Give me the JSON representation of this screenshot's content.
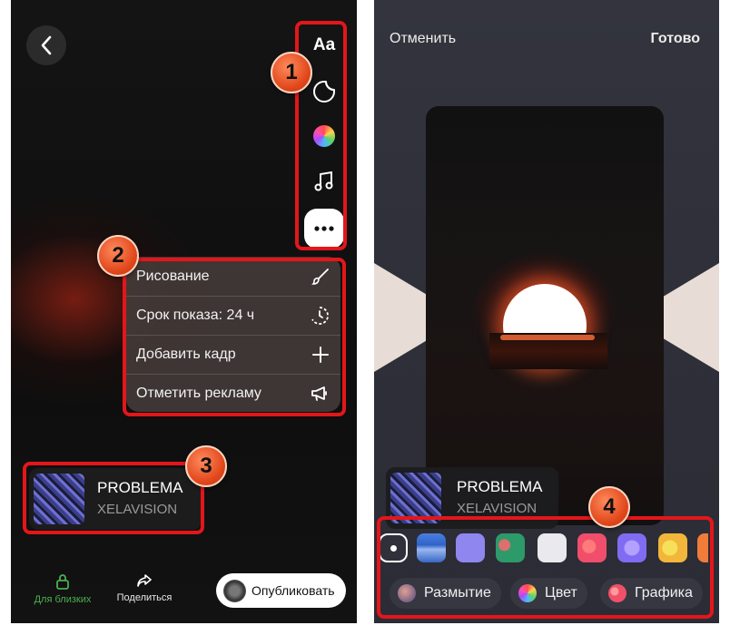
{
  "left": {
    "menu_items": [
      {
        "label": "Рисование",
        "icon": "brush-icon"
      },
      {
        "label": "Срок показа: 24 ч",
        "icon": "timer-icon"
      },
      {
        "label": "Добавить кадр",
        "icon": "plus-icon"
      },
      {
        "label": "Отметить рекламу",
        "icon": "megaphone-icon"
      }
    ],
    "text_tool_label": "Aa",
    "track": {
      "title": "PROBLEMA",
      "artist": "XELAVISION"
    },
    "bottom": {
      "close_friends": "Для близких",
      "share": "Поделиться",
      "publish": "Опубликовать"
    },
    "badges": [
      "1",
      "2",
      "3"
    ]
  },
  "right": {
    "cancel": "Отменить",
    "done": "Готово",
    "track": {
      "title": "PROBLEMA",
      "artist": "XELAVISION"
    },
    "chips": [
      {
        "label": "Размытие",
        "icon": "blur-icon"
      },
      {
        "label": "Цвет",
        "icon": "color-icon"
      },
      {
        "label": "Графика",
        "icon": "graphic-icon"
      }
    ],
    "badge": "4"
  },
  "colors": {
    "highlight": "#e4161a",
    "badge": "#e0461a",
    "close_friends_green": "#4caf50"
  }
}
